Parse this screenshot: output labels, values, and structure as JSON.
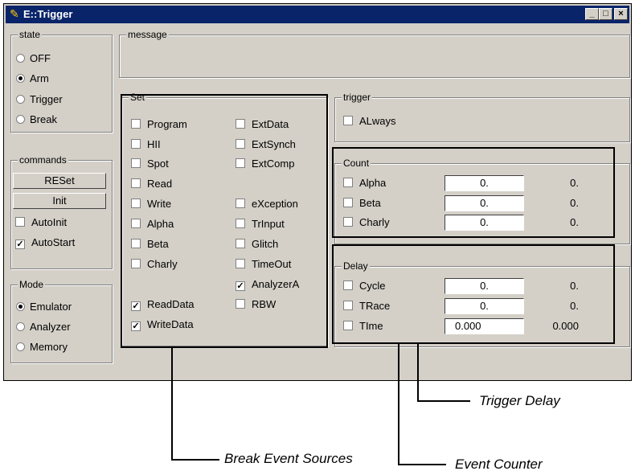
{
  "window": {
    "title": "E::Trigger",
    "buttons": [
      "_",
      "□",
      "×"
    ]
  },
  "state": {
    "label": "state",
    "options": [
      "OFF",
      "Arm",
      "Trigger",
      "Break"
    ],
    "selected": "Arm"
  },
  "commands": {
    "label": "commands",
    "reset": "RESet",
    "init": "Init",
    "autoinit": {
      "label": "AutoInit",
      "checked": false
    },
    "autostart": {
      "label": "AutoStart",
      "checked": true
    }
  },
  "mode": {
    "label": "Mode",
    "options": [
      "Emulator",
      "Analyzer",
      "Memory"
    ],
    "selected": "Emulator"
  },
  "message": {
    "label": "message"
  },
  "set": {
    "label": "Set",
    "col1": [
      {
        "label": "Program",
        "checked": false
      },
      {
        "label": "HII",
        "checked": false
      },
      {
        "label": "Spot",
        "checked": false
      },
      {
        "label": "Read",
        "checked": false
      },
      {
        "label": "Write",
        "checked": false
      },
      {
        "label": "Alpha",
        "checked": false
      },
      {
        "label": "Beta",
        "checked": false
      },
      {
        "label": "Charly",
        "checked": false
      },
      {
        "label": "ReadData",
        "checked": true
      },
      {
        "label": "WriteData",
        "checked": true
      }
    ],
    "col2": [
      {
        "label": "ExtData",
        "checked": false
      },
      {
        "label": "ExtSynch",
        "checked": false
      },
      {
        "label": "ExtComp",
        "checked": false
      },
      {
        "label": "eXception",
        "checked": false
      },
      {
        "label": "TrInput",
        "checked": false
      },
      {
        "label": "Glitch",
        "checked": false
      },
      {
        "label": "TimeOut",
        "checked": false
      },
      {
        "label": "AnalyzerA",
        "checked": true
      },
      {
        "label": "RBW",
        "checked": false
      }
    ]
  },
  "trigger": {
    "label": "trigger",
    "always": {
      "label": "ALways",
      "checked": false
    }
  },
  "count": {
    "label": "Count",
    "rows": [
      {
        "label": "Alpha",
        "value": "0.",
        "readout": "0."
      },
      {
        "label": "Beta",
        "value": "0.",
        "readout": "0."
      },
      {
        "label": "Charly",
        "value": "0.",
        "readout": "0."
      }
    ]
  },
  "delay": {
    "label": "Delay",
    "rows": [
      {
        "label": "Cycle",
        "value": "0.",
        "readout": "0."
      },
      {
        "label": "TRace",
        "value": "0.",
        "readout": "0."
      },
      {
        "label": "TIme",
        "value": "0.000",
        "readout": "0.000"
      }
    ]
  },
  "callouts": {
    "trigger_delay": "Trigger Delay",
    "break_sources": "Break Event Sources",
    "event_counter": "Event Counter"
  }
}
